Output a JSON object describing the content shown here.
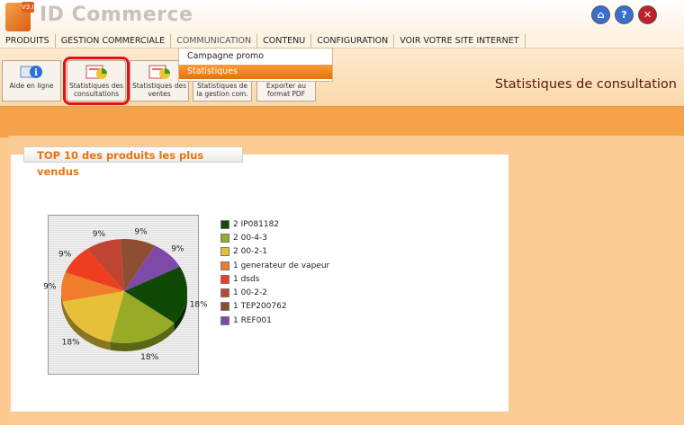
{
  "app": {
    "brand": "ID Commerce",
    "version_badge": "V3.0"
  },
  "top_icons": [
    {
      "name": "home-icon",
      "glyph": "⌂"
    },
    {
      "name": "help-icon",
      "glyph": "?"
    },
    {
      "name": "close-icon",
      "glyph": "✕"
    }
  ],
  "menu": [
    {
      "label": "PRODUITS"
    },
    {
      "label": "GESTION COMMERCIALE"
    },
    {
      "label": "COMMUNICATION"
    },
    {
      "label": "CONTENU"
    },
    {
      "label": "CONFIGURATION"
    },
    {
      "label": "VOIR VOTRE SITE INTERNET"
    }
  ],
  "dropdown": [
    {
      "label": "Campagne promo"
    },
    {
      "label": "Statistiques"
    }
  ],
  "toolbar": [
    {
      "label": "Aide en ligne",
      "icon": "info-icon"
    },
    {
      "label": "Statistiques des consultations",
      "icon": "stats-chart-icon"
    },
    {
      "label": "Statistiques des ventes",
      "icon": "stats-chart-icon"
    },
    {
      "label": "Statistiques de la gestion com.",
      "icon": "stats-chart-icon"
    },
    {
      "label": "Exporter au format PDF",
      "icon": "pdf-export-icon"
    }
  ],
  "page_title": "Statistiques de consultation",
  "panel_title": "TOP 10 des produits les plus vendus",
  "chart_data": {
    "type": "pie",
    "title": "",
    "slices": [
      {
        "label": "2 IP081182",
        "value": 2,
        "percent": "18%",
        "color": "#0e4a06"
      },
      {
        "label": "2 00-4-3",
        "value": 2,
        "percent": "18%",
        "color": "#97ab26"
      },
      {
        "label": "2 00-2-1",
        "value": 2,
        "percent": "18%",
        "color": "#e7c03a"
      },
      {
        "label": "1 generateur de vapeur",
        "value": 1,
        "percent": "9%",
        "color": "#ef7d2a"
      },
      {
        "label": "1 dsds",
        "value": 1,
        "percent": "9%",
        "color": "#ee3e1f"
      },
      {
        "label": "1 00-2-2",
        "value": 1,
        "percent": "9%",
        "color": "#c04432"
      },
      {
        "label": "1 TEP200762",
        "value": 1,
        "percent": "9%",
        "color": "#8e4e34"
      },
      {
        "label": "1 REF001",
        "value": 1,
        "percent": "9%",
        "color": "#7e4aa8"
      }
    ],
    "legend_position": "right"
  }
}
